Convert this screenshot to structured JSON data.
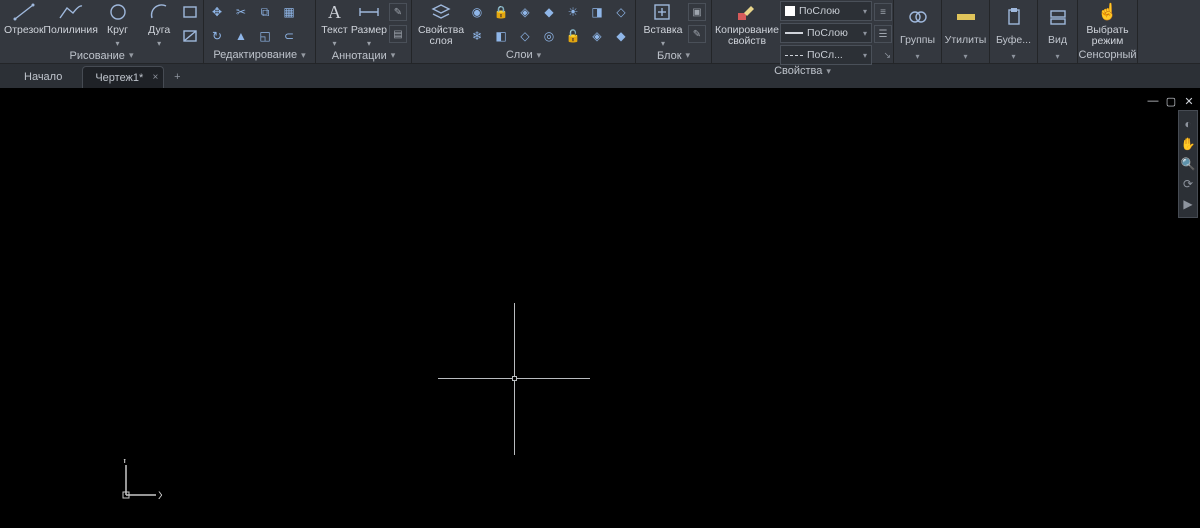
{
  "ribbon": {
    "draw": {
      "panel": "Рисование",
      "line": "Отрезок",
      "polyline": "Полилиния",
      "circle": "Круг",
      "arc": "Дуга"
    },
    "edit": {
      "panel": "Редактирование"
    },
    "annot": {
      "panel": "Аннотации",
      "text": "Текст",
      "dim": "Размер"
    },
    "layers": {
      "panel": "Слои",
      "props": "Свойства слоя"
    },
    "block": {
      "panel": "Блок",
      "insert": "Вставка"
    },
    "props": {
      "panel": "Свойства",
      "copy": "Копирование свойств",
      "bylayer": "ПоСлою",
      "bylayer2": "ПоСлою",
      "bylayer3": "ПоСл..."
    },
    "groups": "Группы",
    "utils": "Утилиты",
    "clip": "Буфе...",
    "view": "Вид",
    "touch": {
      "label": "Выбрать режим",
      "panel": "Сенсорный"
    }
  },
  "tabs": {
    "home": "Начало",
    "active": "Чертеж1*"
  },
  "ucs": {
    "x": "X",
    "y": "Y"
  }
}
